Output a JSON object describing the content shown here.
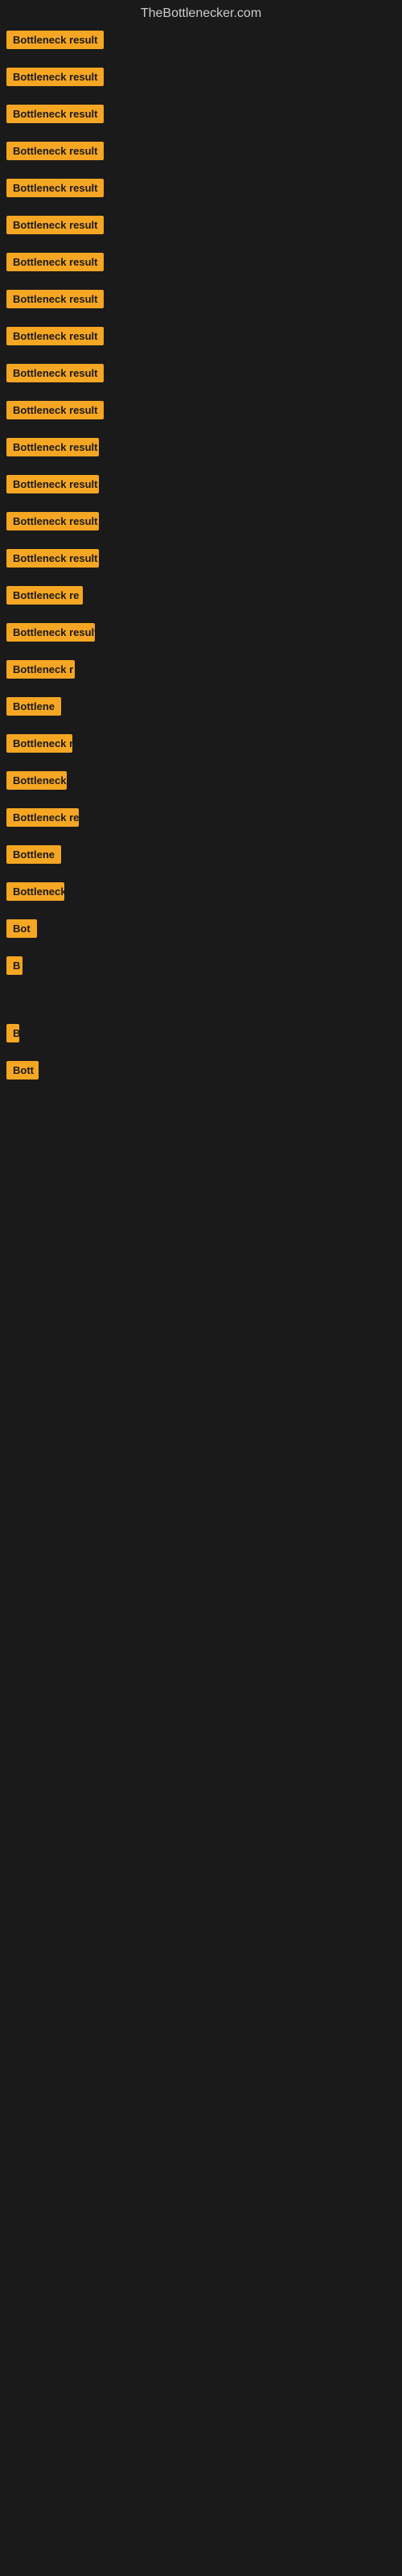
{
  "header": {
    "title": "TheBottlenecker.com"
  },
  "items": [
    {
      "label": "Bottleneck result",
      "width": 130
    },
    {
      "label": "Bottleneck result",
      "width": 130
    },
    {
      "label": "Bottleneck result",
      "width": 130
    },
    {
      "label": "Bottleneck result",
      "width": 130
    },
    {
      "label": "Bottleneck result",
      "width": 130
    },
    {
      "label": "Bottleneck result",
      "width": 130
    },
    {
      "label": "Bottleneck result",
      "width": 130
    },
    {
      "label": "Bottleneck result",
      "width": 130
    },
    {
      "label": "Bottleneck result",
      "width": 130
    },
    {
      "label": "Bottleneck result",
      "width": 130
    },
    {
      "label": "Bottleneck result",
      "width": 130
    },
    {
      "label": "Bottleneck result",
      "width": 115
    },
    {
      "label": "Bottleneck result",
      "width": 115
    },
    {
      "label": "Bottleneck result",
      "width": 115
    },
    {
      "label": "Bottleneck result",
      "width": 115
    },
    {
      "label": "Bottleneck re",
      "width": 95
    },
    {
      "label": "Bottleneck result",
      "width": 110
    },
    {
      "label": "Bottleneck r",
      "width": 85
    },
    {
      "label": "Bottlene",
      "width": 70
    },
    {
      "label": "Bottleneck r",
      "width": 82
    },
    {
      "label": "Bottleneck",
      "width": 75
    },
    {
      "label": "Bottleneck re",
      "width": 90
    },
    {
      "label": "Bottlene",
      "width": 68
    },
    {
      "label": "Bottleneck",
      "width": 72
    },
    {
      "label": "Bot",
      "width": 38
    },
    {
      "label": "B",
      "width": 20
    },
    {
      "label": "",
      "width": 0
    },
    {
      "label": "B",
      "width": 16
    },
    {
      "label": "Bott",
      "width": 40
    },
    {
      "label": "",
      "width": 0
    },
    {
      "label": "",
      "width": 0
    },
    {
      "label": "",
      "width": 0
    },
    {
      "label": "",
      "width": 0
    }
  ]
}
